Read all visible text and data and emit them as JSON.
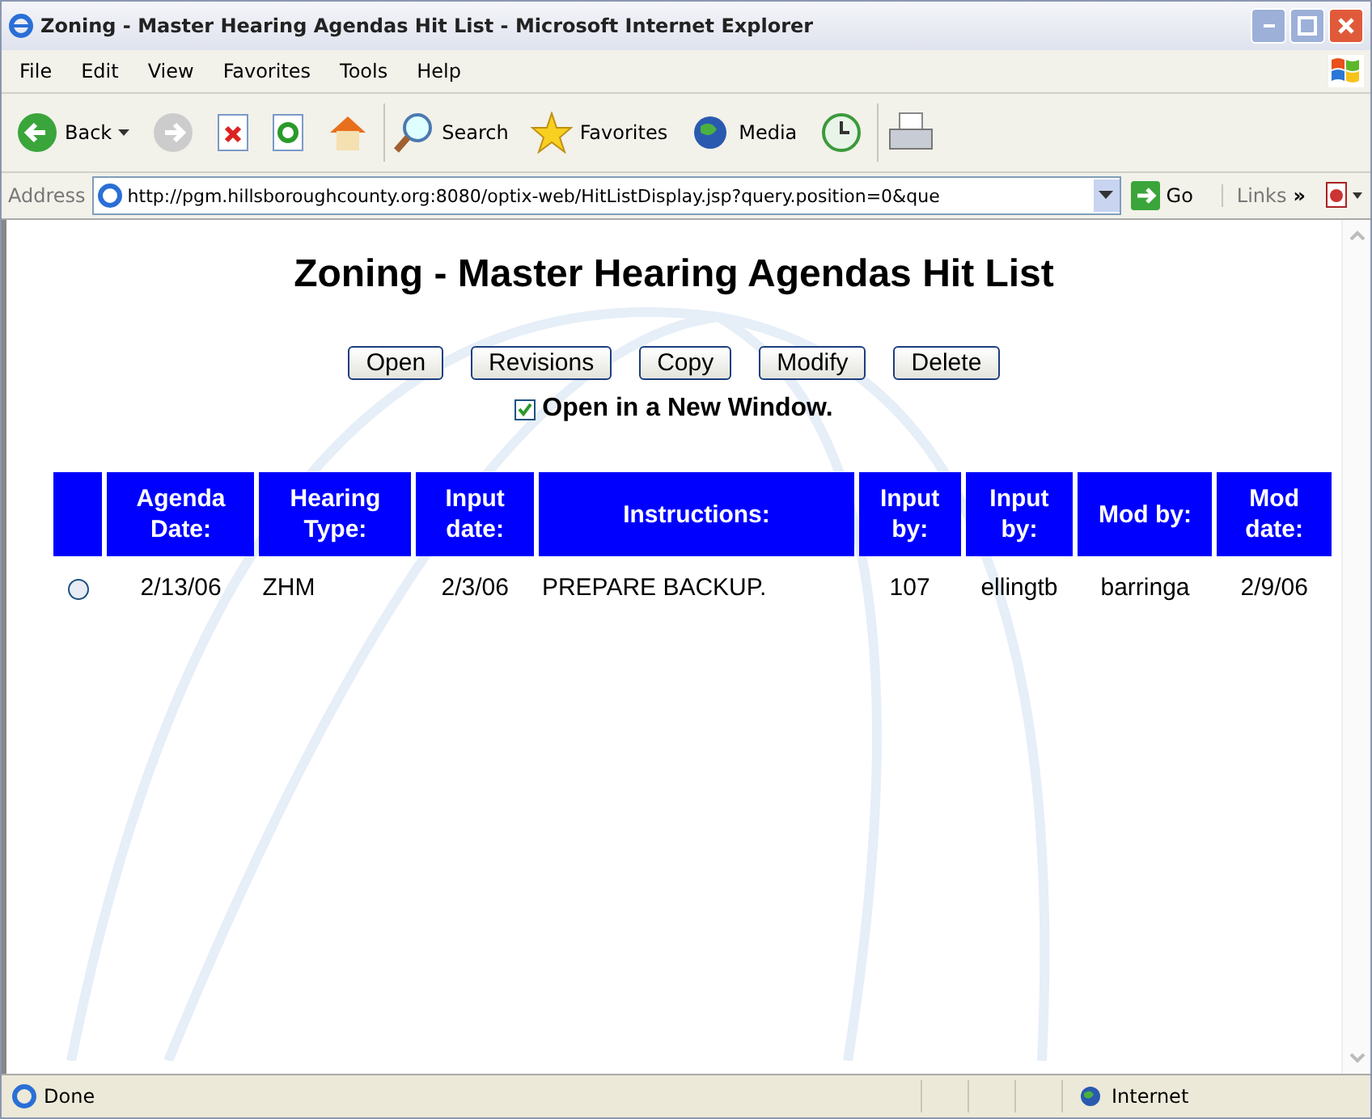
{
  "window": {
    "title": "Zoning - Master Hearing Agendas Hit List - Microsoft Internet Explorer"
  },
  "menu": [
    {
      "label": "File"
    },
    {
      "label": "Edit"
    },
    {
      "label": "View"
    },
    {
      "label": "Favorites"
    },
    {
      "label": "Tools"
    },
    {
      "label": "Help"
    }
  ],
  "toolbar": [
    {
      "kind": "back",
      "label": "Back"
    },
    {
      "kind": "forward"
    },
    {
      "kind": "stop"
    },
    {
      "kind": "refresh"
    },
    {
      "kind": "home"
    },
    {
      "kind": "search",
      "label": "Search"
    },
    {
      "kind": "favorites",
      "label": "Favorites"
    },
    {
      "kind": "media",
      "label": "Media"
    },
    {
      "kind": "history"
    },
    {
      "kind": "print"
    }
  ],
  "address_bar": {
    "label": "Address",
    "value": "http://pgm.hillsboroughcounty.org:8080/optix-web/HitListDisplay.jsp?query.position=0&que",
    "go": "Go",
    "links": "Links",
    "chevron": "»"
  },
  "page": {
    "heading": "Zoning - Master Hearing Agendas Hit List",
    "buttons": [
      "Open",
      "Revisions",
      "Copy",
      "Modify",
      "Delete"
    ],
    "new_window": {
      "label": "Open in a New Window.",
      "checked": true
    },
    "table": {
      "columns": [
        "Agenda Date:",
        "Hearing Type:",
        "Input date:",
        "Instructions:",
        "Input by:",
        "Input by:",
        "Mod by:",
        "Mod date:"
      ],
      "rows": [
        {
          "selected": false,
          "cells": [
            "2/13/06",
            "ZHM",
            "2/3/06",
            "PREPARE BACKUP.",
            "107",
            "ellingtb",
            "barringa",
            "2/9/06"
          ]
        }
      ]
    }
  },
  "status_bar": {
    "text": "Done",
    "zone": "Internet"
  }
}
